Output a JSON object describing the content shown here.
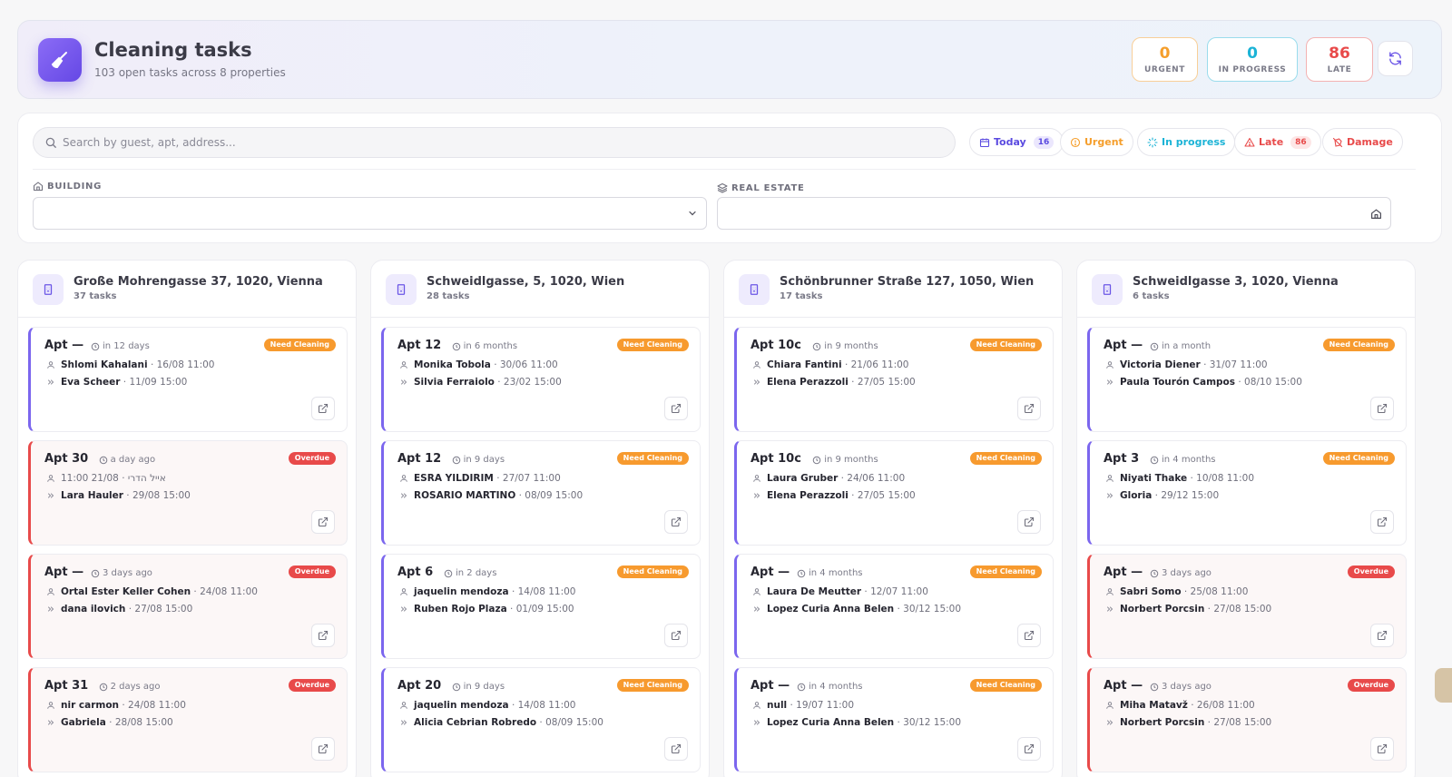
{
  "header": {
    "title": "Cleaning tasks",
    "subtitle": "103 open tasks across 8 properties",
    "stats": {
      "urgent": {
        "value": "0",
        "label": "URGENT"
      },
      "in_progress": {
        "value": "0",
        "label": "IN PROGRESS"
      },
      "late": {
        "value": "86",
        "label": "LATE"
      }
    }
  },
  "filters": {
    "search_placeholder": "Search by guest, apt, address...",
    "chips": {
      "today": {
        "label": "Today",
        "count": "16"
      },
      "urgent": {
        "label": "Urgent"
      },
      "in_progress": {
        "label": "In progress"
      },
      "late": {
        "label": "Late",
        "count": "86"
      },
      "damage": {
        "label": "Damage"
      }
    },
    "building_label": "BUILDING",
    "real_estate_label": "REAL ESTATE"
  },
  "columns": [
    {
      "title": "Große Mohrengasse 37, 1020, Vienna",
      "count": "37 tasks",
      "cards": [
        {
          "apt": "Apt —",
          "when": "in 12 days",
          "status": "Need Cleaning",
          "overdue": false,
          "checkin_name": "Shlomi Kahalani",
          "checkin_date": "· 16/08 11:00",
          "checkout_name": "Eva Scheer",
          "checkout_date": "· 11/09 15:00"
        },
        {
          "apt": "Apt 30",
          "when": "a day ago",
          "status": "Overdue",
          "overdue": true,
          "checkin_name": "",
          "checkin_date": "11:00 21/08 · אייל הדרי",
          "checkout_name": "Lara Hauler",
          "checkout_date": "· 29/08 15:00"
        },
        {
          "apt": "Apt —",
          "when": "3 days ago",
          "status": "Overdue",
          "overdue": true,
          "checkin_name": "Ortal Ester Keller Cohen",
          "checkin_date": "· 24/08 11:00",
          "checkout_name": "dana ilovich",
          "checkout_date": "· 27/08 15:00"
        },
        {
          "apt": "Apt 31",
          "when": "2 days ago",
          "status": "Overdue",
          "overdue": true,
          "checkin_name": "nir carmon",
          "checkin_date": "· 24/08 11:00",
          "checkout_name": "Gabriela",
          "checkout_date": "· 28/08 15:00"
        }
      ]
    },
    {
      "title": "Schweidlgasse, 5, 1020, Wien",
      "count": "28 tasks",
      "cards": [
        {
          "apt": "Apt 12",
          "when": "in 6 months",
          "status": "Need Cleaning",
          "overdue": false,
          "checkin_name": "Monika Tobola",
          "checkin_date": "· 30/06 11:00",
          "checkout_name": "Silvia Ferraiolo",
          "checkout_date": "· 23/02 15:00"
        },
        {
          "apt": "Apt 12",
          "when": "in 9 days",
          "status": "Need Cleaning",
          "overdue": false,
          "checkin_name": "ESRA YILDIRIM",
          "checkin_date": "· 27/07 11:00",
          "checkout_name": "ROSARIO MARTINO",
          "checkout_date": "· 08/09 15:00"
        },
        {
          "apt": "Apt 6",
          "when": "in 2 days",
          "status": "Need Cleaning",
          "overdue": false,
          "checkin_name": "jaquelin mendoza",
          "checkin_date": "· 14/08 11:00",
          "checkout_name": "Ruben Rojo Plaza",
          "checkout_date": "· 01/09 15:00"
        },
        {
          "apt": "Apt 20",
          "when": "in 9 days",
          "status": "Need Cleaning",
          "overdue": false,
          "checkin_name": "jaquelin mendoza",
          "checkin_date": "· 14/08 11:00",
          "checkout_name": "Alicia Cebrian Robredo",
          "checkout_date": "· 08/09 15:00"
        }
      ]
    },
    {
      "title": "Schönbrunner Straße 127, 1050, Wien",
      "count": "17 tasks",
      "cards": [
        {
          "apt": "Apt 10c",
          "when": "in 9 months",
          "status": "Need Cleaning",
          "overdue": false,
          "checkin_name": "Chiara Fantini",
          "checkin_date": "· 21/06 11:00",
          "checkout_name": "Elena Perazzoli",
          "checkout_date": "· 27/05 15:00"
        },
        {
          "apt": "Apt 10c",
          "when": "in 9 months",
          "status": "Need Cleaning",
          "overdue": false,
          "checkin_name": "Laura Gruber",
          "checkin_date": "· 24/06 11:00",
          "checkout_name": "Elena Perazzoli",
          "checkout_date": "· 27/05 15:00"
        },
        {
          "apt": "Apt —",
          "when": "in 4 months",
          "status": "Need Cleaning",
          "overdue": false,
          "checkin_name": "Laura De Meutter",
          "checkin_date": "· 12/07 11:00",
          "checkout_name": "Lopez Curia Anna Belen",
          "checkout_date": "· 30/12 15:00"
        },
        {
          "apt": "Apt —",
          "when": "in 4 months",
          "status": "Need Cleaning",
          "overdue": false,
          "checkin_name": "null",
          "checkin_date": "· 19/07 11:00",
          "checkout_name": "Lopez Curia Anna Belen",
          "checkout_date": "· 30/12 15:00"
        }
      ]
    },
    {
      "title": "Schweidlgasse 3, 1020, Vienna",
      "count": "6 tasks",
      "cards": [
        {
          "apt": "Apt —",
          "when": "in a month",
          "status": "Need Cleaning",
          "overdue": false,
          "checkin_name": "Victoria Diener",
          "checkin_date": "· 31/07 11:00",
          "checkout_name": "Paula Tourón Campos",
          "checkout_date": "· 08/10 15:00"
        },
        {
          "apt": "Apt 3",
          "when": "in 4 months",
          "status": "Need Cleaning",
          "overdue": false,
          "checkin_name": "Niyati Thake",
          "checkin_date": "· 10/08 11:00",
          "checkout_name": "Gloria",
          "checkout_date": "· 29/12 15:00"
        },
        {
          "apt": "Apt —",
          "when": "3 days ago",
          "status": "Overdue",
          "overdue": true,
          "checkin_name": "Sabri Somo",
          "checkin_date": "· 25/08 11:00",
          "checkout_name": "Norbert Porcsin",
          "checkout_date": "· 27/08 15:00"
        },
        {
          "apt": "Apt —",
          "when": "3 days ago",
          "status": "Overdue",
          "overdue": true,
          "checkin_name": "Miha Matavž",
          "checkin_date": "· 26/08 11:00",
          "checkout_name": "Norbert Porcsin",
          "checkout_date": "· 27/08 15:00"
        }
      ]
    }
  ],
  "icons": {
    "logo": "broom-icon",
    "refresh": "refresh-icon",
    "search": "search-icon",
    "building": "building-icon",
    "guest": "user-icon",
    "checkout": "chevrons-right-icon",
    "open": "external-link-icon"
  },
  "colors": {
    "accent": "#6548e5",
    "urgent": "#f59e2b",
    "in_progress": "#1bb3d6",
    "late": "#e84a4a"
  }
}
